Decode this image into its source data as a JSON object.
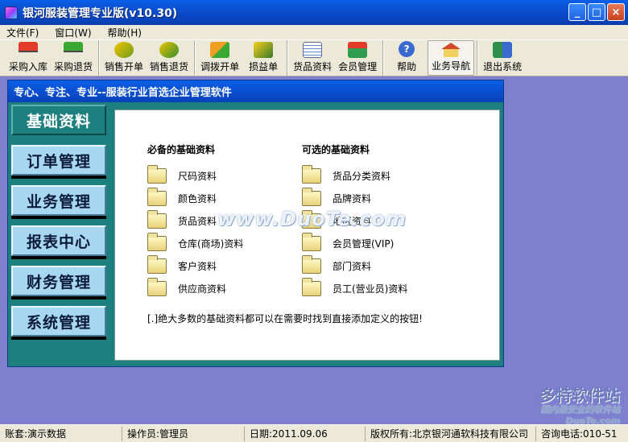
{
  "window": {
    "title": "银河服装管理专业版(v10.30)",
    "controls": [
      "_",
      "□",
      "×"
    ]
  },
  "menu": {
    "items": [
      "文件(F)",
      "窗口(W)",
      "帮助(H)"
    ]
  },
  "toolbar": {
    "groups": [
      [
        {
          "label": "采购入库",
          "icon": "truck-red-icon"
        },
        {
          "label": "采购退货",
          "icon": "truck-green-icon"
        }
      ],
      [
        {
          "label": "销售开单",
          "icon": "sell-icon"
        },
        {
          "label": "销售退货",
          "icon": "sell-return-icon"
        }
      ],
      [
        {
          "label": "调拨开单",
          "icon": "transfer-icon"
        },
        {
          "label": "损益单",
          "icon": "loss-icon"
        }
      ],
      [
        {
          "label": "货品资料",
          "icon": "goods-icon"
        },
        {
          "label": "会员管理",
          "icon": "member-icon"
        }
      ],
      [
        {
          "label": "帮助",
          "icon": "help-icon"
        },
        {
          "label": "业务导航",
          "icon": "home-icon"
        }
      ],
      [
        {
          "label": "退出系统",
          "icon": "exit-icon"
        }
      ]
    ]
  },
  "inner_window": {
    "title": "专心、专注、专业--服装行业首选企业管理软件"
  },
  "nav": {
    "items": [
      "基础资料",
      "订单管理",
      "业务管理",
      "报表中心",
      "财务管理",
      "系统管理"
    ],
    "selected": 0
  },
  "content": {
    "required": {
      "heading": "必备的基础资料",
      "items": [
        "尺码资料",
        "颜色资料",
        "货品资料",
        "仓库(商场)资料",
        "客户资料",
        "供应商资料"
      ]
    },
    "optional": {
      "heading": "可选的基础资料",
      "items": [
        "货品分类资料",
        "品牌资料",
        "地区资料",
        "会员管理(VIP)",
        "部门资料",
        "员工(营业员)资料"
      ]
    },
    "note": "[.]绝大多数的基础资料都可以在需要时找到直接添加定义的按钮!"
  },
  "watermark": {
    "center": "www.DuoTe.com",
    "corner": "多特软件站",
    "corner_sub": "国内最安全的软件站",
    "corner_url": "DuoTe.com"
  },
  "status": {
    "account": "账套:演示数据",
    "operator": "操作员:管理员",
    "date": "日期:2011.09.06",
    "copyright": "版权所有:北京银河通软科技有限公司",
    "phone": "咨询电话:010-51"
  }
}
